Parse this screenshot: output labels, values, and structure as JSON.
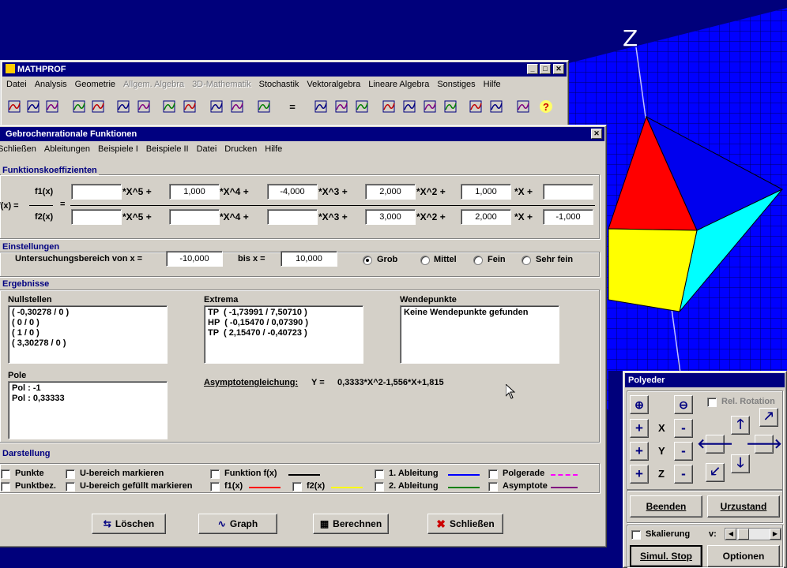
{
  "main_window": {
    "title": "MATHPROF",
    "menu": [
      "Datei",
      "Analysis",
      "Geometrie",
      "Allgem. Algebra",
      "3D-Mathematik",
      "Stochastik",
      "Vektoralgebra",
      "Lineare Algebra",
      "Sonstiges",
      "Hilfe"
    ],
    "toolbar_icons": [
      "graph-icon",
      "curve-icon",
      "grid-icon",
      "scatter-icon",
      "area-icon",
      "derivative-icon",
      "integral-icon",
      "function-icon",
      "roots-icon",
      "intersection-icon",
      "cross-icon",
      "bar-chart-icon",
      "equals-icon",
      "table-icon",
      "spreadsheet-icon",
      "histogram-icon",
      "cone-icon",
      "surface-icon",
      "3d-curve-icon",
      "3d-graph-icon",
      "matrix-icon",
      "matrix2-icon",
      "flag-icon",
      "help-icon"
    ],
    "equals_glyph": "=",
    "help_glyph": "?"
  },
  "dialog": {
    "title": "Gebrochenrationale Funktionen",
    "close_glyph": "✕",
    "menu": [
      "Schließen",
      "Ableitungen",
      "Beispiele I",
      "Beispiele II",
      "Datei",
      "Drucken",
      "Hilfe"
    ],
    "coeff": {
      "label": "Funktionskoeffizienten",
      "fx": "f(x) =",
      "f1": "f1(x)",
      "f2": "f2(x)",
      "eq": "=",
      "terms": [
        "*X^5 +",
        "*X^4 +",
        "*X^3 +",
        "*X^2 +",
        "*X +"
      ],
      "row1": [
        "",
        "1,000",
        "-4,000",
        "2,000",
        "1,000",
        ""
      ],
      "row2": [
        "",
        "",
        "",
        "3,000",
        "2,000",
        "-1,000"
      ]
    },
    "settings": {
      "label": "Einstellungen",
      "range_from_label": "Untersuchungsbereich von x =",
      "range_from": "-10,000",
      "range_to_label": "bis x =",
      "range_to": "10,000",
      "options": [
        "Grob",
        "Mittel",
        "Fein",
        "Sehr fein"
      ],
      "selected": "Grob"
    },
    "results": {
      "label": "Ergebnisse",
      "nullstellen_label": "Nullstellen",
      "nullstellen": [
        "( -0,30278 / 0 )",
        "( 0 / 0 )",
        "( 1 / 0 )",
        "( 3,30278 / 0 )"
      ],
      "extrema_label": "Extrema",
      "extrema": [
        "TP  ( -1,73991 / 7,50710 )",
        "HP  ( -0,15470 / 0,07390 )",
        "TP  ( 2,15470 / -0,40723 )"
      ],
      "wende_label": "Wendepunkte",
      "wende": [
        "Keine Wendepunkte gefunden"
      ],
      "pole_label": "Pole",
      "pole": [
        "Pol : -1",
        "Pol : 0,33333"
      ],
      "asym_label": "Asymptotengleichung:",
      "asym_y": "Y =",
      "asym_eq": "0,3333*X^2-1,556*X+1,815"
    },
    "display": {
      "label": "Darstellung",
      "items": [
        {
          "label": "Punkte",
          "checked": false
        },
        {
          "label": "Punktbez.",
          "checked": false
        },
        {
          "label": "U-bereich markieren",
          "checked": false
        },
        {
          "label": "U-bereich gefüllt markieren",
          "checked": false
        },
        {
          "label": "Funktion f(x)",
          "checked": false,
          "color": "#000000"
        },
        {
          "label": "f1(x)",
          "checked": false,
          "color": "#ff0000"
        },
        {
          "label": "f2(x)",
          "checked": false,
          "color": "#ffff00"
        },
        {
          "label": "1. Ableitung",
          "checked": false,
          "color": "#0000ff"
        },
        {
          "label": "2. Ableitung",
          "checked": false,
          "color": "#008000"
        },
        {
          "label": "Polgerade",
          "checked": false,
          "color": "#ff00ff"
        },
        {
          "label": "Asymptote",
          "checked": false,
          "color": "#800080"
        }
      ]
    },
    "buttons": {
      "loeschen": "Löschen",
      "graph": "Graph",
      "berechnen": "Berechnen",
      "schliessen": "Schließen"
    }
  },
  "polyeder": {
    "title": "Polyeder",
    "rel_rotation": "Rel. Rotation",
    "axes": [
      "X",
      "Y",
      "Z"
    ],
    "plus": "+",
    "minus": "-",
    "beenden": "Beenden",
    "urzustand": "Urzustand",
    "skalierung": "Skalierung",
    "v": "v:",
    "simul_stop": "Simul. Stop",
    "optionen": "Optionen"
  },
  "scene_axis_label": "Z",
  "colors": {
    "face_red": "#ff0000",
    "face_yellow": "#ffff00",
    "face_cyan": "#00ffff",
    "face_blue": "#0000ff",
    "grid_bg": "#0000ff",
    "title_bar": "#000080"
  }
}
